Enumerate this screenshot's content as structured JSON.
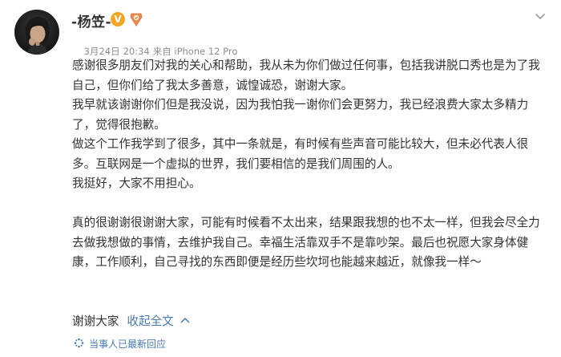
{
  "author": {
    "name": "-杨笠-",
    "verified_badge": "V",
    "badge_color": "#f4a623"
  },
  "meta": {
    "date": "3月24日",
    "time": "20:34",
    "source": "来自 iPhone 12 Pro"
  },
  "post": {
    "paragraphs": [
      "感谢很多朋友们对我的关心和帮助，我从未为你们做过任何事，包括我讲脱口秀也是为了我自己，但你们给了我太多善意，诚惶诚恐，谢谢大家。",
      "我早就该谢谢你们但是我没说，因为我怕我一谢你们会更努力，我已经浪费大家太多精力了，觉得很抱歉。",
      "做这个工作我学到了很多，其中一条就是，有时候有些声音可能比较大，但未必代表人很多。互联网是一个虚拟的世界，我们要相信的是我们周围的人。",
      "我挺好，大家不用担心。",
      "",
      "真的很谢谢很谢谢大家，可能有时候看不太出来，结果跟我想的也不太一样，但我会尽全力去做我想做的事情，去维护我自己。幸福生活靠双手不是靠吵架。最后也祝愿大家身体健康，工作顺利，自己寻找的东西即便是经历些坎坷也能越来越近，就像我一样～"
    ],
    "closing": "谢谢大家",
    "collapse_label": "收起全文"
  },
  "footer": {
    "note": "当事人已最新回应"
  },
  "colors": {
    "link": "#4a7cb4",
    "text": "#333333",
    "meta": "#8d8d8d"
  },
  "icons": {
    "avatar": "avatar",
    "menu": "chevron-down-icon",
    "collapse": "chevron-up-icon",
    "note": "sparkle-icon",
    "level": "level-badge-icon"
  }
}
